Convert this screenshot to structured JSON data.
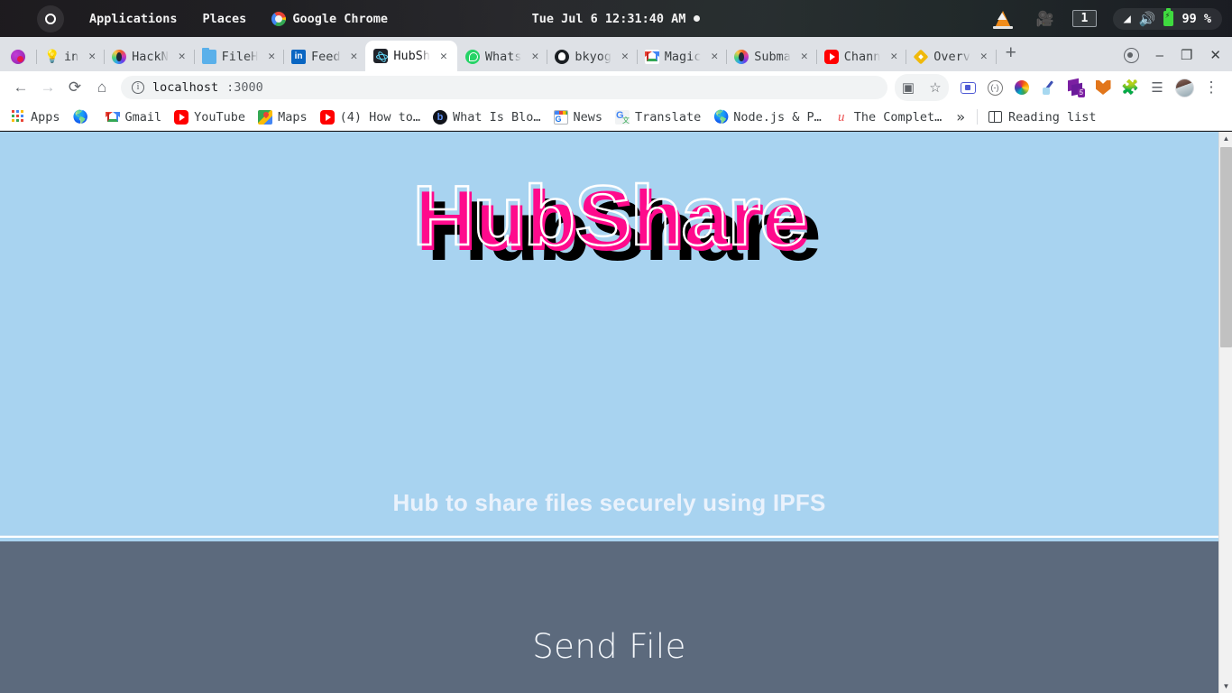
{
  "desktop": {
    "activities_label": "activities-button",
    "menus": [
      "Applications",
      "Places"
    ],
    "app_menu": "Google Chrome",
    "clock": "Tue Jul 6 12:31:40 AM",
    "tray": {
      "vlc": "vlc-icon",
      "recorder": "screen-recorder-icon",
      "workspace": "1",
      "wifi": "📶",
      "volume": "🔊",
      "battery_percent": "99 %"
    }
  },
  "browser": {
    "tabs": [
      {
        "title": "",
        "favicon": "pinned-purple-icon",
        "pinned": true,
        "active": false
      },
      {
        "title": "in",
        "favicon": "lightbulb-icon",
        "pinned": false,
        "active": false
      },
      {
        "title": "HackN",
        "favicon": "hackerearth-icon",
        "pinned": false,
        "active": false
      },
      {
        "title": "FileH",
        "favicon": "folder-icon",
        "pinned": false,
        "active": false
      },
      {
        "title": "Feed",
        "favicon": "linkedin-icon",
        "pinned": false,
        "active": false
      },
      {
        "title": "HubSh",
        "favicon": "react-icon",
        "pinned": false,
        "active": true
      },
      {
        "title": "Whats",
        "favicon": "whatsapp-icon",
        "pinned": false,
        "active": false
      },
      {
        "title": "bkyog",
        "favicon": "github-icon",
        "pinned": false,
        "active": false
      },
      {
        "title": "Magic",
        "favicon": "gmail-icon",
        "pinned": false,
        "active": false
      },
      {
        "title": "Subma",
        "favicon": "hackerearth-icon",
        "pinned": false,
        "active": false
      },
      {
        "title": "Chann",
        "favicon": "youtube-icon",
        "pinned": false,
        "active": false
      },
      {
        "title": "Overv",
        "favicon": "binance-icon",
        "pinned": false,
        "active": false
      }
    ],
    "new_tab_label": "+",
    "window_controls": {
      "shield": "tracking-protection-icon",
      "minimize": "–",
      "maximize": "❐",
      "close": "✕"
    },
    "toolbar": {
      "back": "←",
      "forward": "→",
      "reload": "⟳",
      "home": "⌂",
      "site_info": "i",
      "url_host": "localhost",
      "url_rest": ":3000",
      "url_full": "localhost:3000",
      "translate": "translate-icon",
      "bookmark_star": "☆",
      "extensions": [
        "screen-capture-icon",
        "circle-dash-icon",
        "color-wheel-icon",
        "eyedropper-icon",
        "layers-badge-icon",
        "metamask-icon",
        "puzzle-icon"
      ],
      "layers_badge": "5",
      "reading_list": "reading-list-icon",
      "profile": "profile-avatar",
      "menu": "⋮"
    },
    "bookmarks": [
      {
        "label": "Apps",
        "icon": "apps-grid-icon"
      },
      {
        "label": "",
        "icon": "globe-icon"
      },
      {
        "label": "Gmail",
        "icon": "gmail-icon"
      },
      {
        "label": "YouTube",
        "icon": "youtube-icon"
      },
      {
        "label": "Maps",
        "icon": "maps-icon"
      },
      {
        "label": "(4) How to…",
        "icon": "youtube-icon"
      },
      {
        "label": "What Is Blo…",
        "icon": "blog-icon"
      },
      {
        "label": "News",
        "icon": "google-news-icon"
      },
      {
        "label": "Translate",
        "icon": "google-translate-icon"
      },
      {
        "label": "Node.js & P…",
        "icon": "globe-icon"
      },
      {
        "label": "The Complet…",
        "icon": "udemy-icon"
      }
    ],
    "bookmarks_overflow": "»",
    "reading_list_label": "Reading list"
  },
  "page": {
    "logo_text": "HubShare",
    "tagline": "Hub to share files securely using IPFS",
    "send_section_title": "Send File",
    "colors": {
      "hero_background": "#a8d3f0",
      "glitch_pink": "#ff0a8c",
      "glitch_black": "#000000",
      "glitch_outline": "#ffffff",
      "tagline": "#eaf2fc",
      "send_section_background": "#5c6a7d",
      "send_title": "#f3f6fa"
    }
  },
  "scrollbar": {
    "up_arrow": "▲",
    "down_arrow": "▼"
  }
}
